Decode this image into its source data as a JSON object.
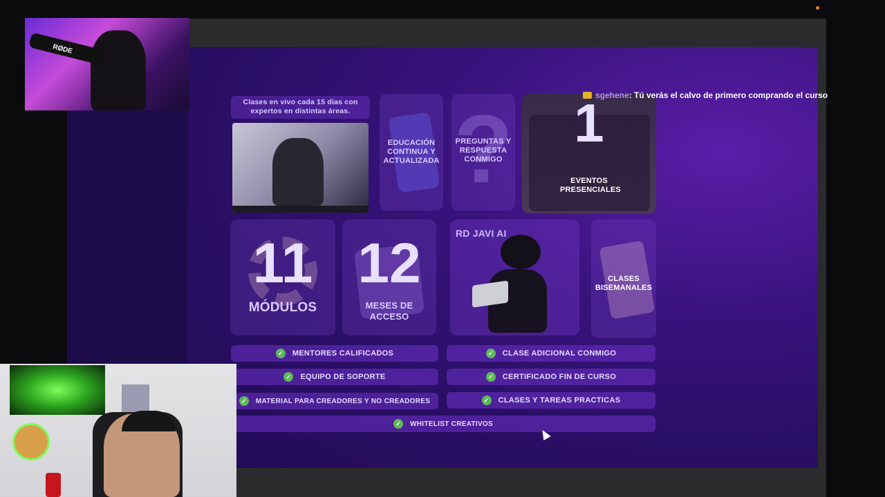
{
  "chat": {
    "user": "sgehene",
    "message": ": Tú verás el calvo de primero comprando el curso"
  },
  "slide": {
    "live_classes_label": "Clases en vivo cada 15 días con expertos en distintas áreas.",
    "tiles": {
      "education": "EDUCACIÓN CONTINUA Y ACTUALIZADA",
      "questions": "PREGUNTAS Y RESPUESTA CONMIGO",
      "questions_mark": "?",
      "events_number": "1",
      "events_label": "EVENTOS PRESENCIALES",
      "modules_number": "11",
      "modules_label": "MÓDULOS",
      "months_number": "12",
      "months_label": "MESES DE ACCESO",
      "ai_label": "RD JAVI AI",
      "biweekly_label": "CLASES BISEMANALES"
    },
    "features_left": [
      "MENTORES CALIFICADOS",
      "EQUIPO DE SOPORTE",
      "MATERIAL PARA CREADORES Y NO CREADORES"
    ],
    "features_right": [
      "CLASE ADICIONAL CONMIGO",
      "CERTIFICADO FIN DE CURSO",
      "CLASES Y TAREAS PRACTICAS"
    ],
    "feature_bottom": "WHITELIST CREATIVOS"
  },
  "webcam_top": {
    "mic_brand": "RØDE"
  },
  "colors": {
    "accent": "#5a1ea8",
    "check": "#5fb85a",
    "chat_user": "#b98cff"
  }
}
